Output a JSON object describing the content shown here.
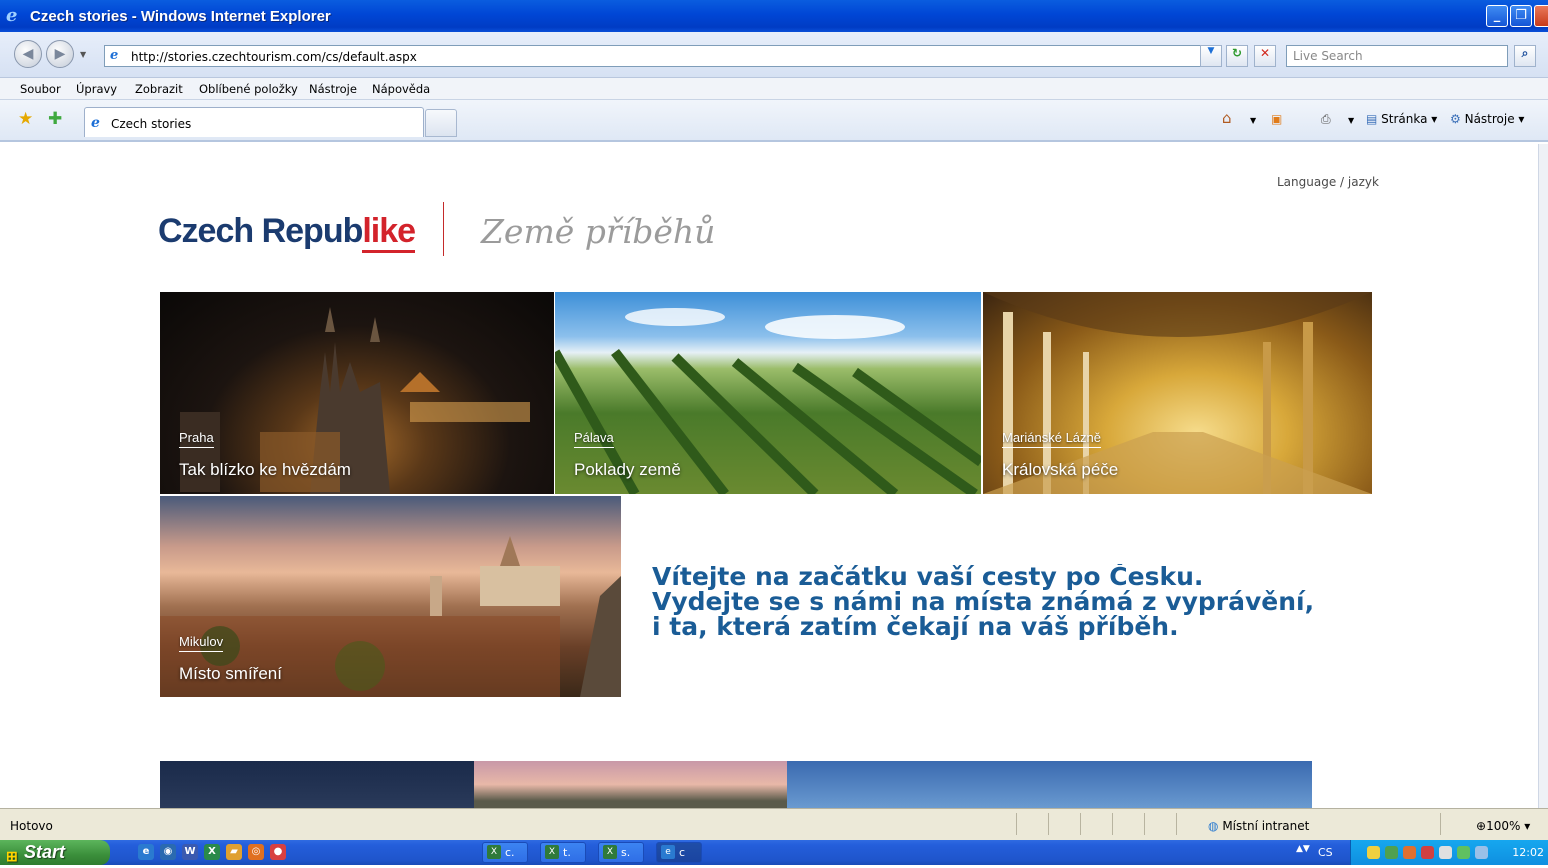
{
  "window": {
    "title": "Czech stories - Windows Internet Explorer",
    "minimize": "_",
    "maximize": "❐",
    "close": "✕"
  },
  "address_bar": {
    "back": "◀",
    "forward": "▶",
    "url": "http://stories.czechtourism.com/cs/default.aspx",
    "refresh": "↻",
    "stop": "✕",
    "search_placeholder": "Live Search",
    "search_go": "⌕"
  },
  "menu": [
    "Soubor",
    "Úpravy",
    "Zobrazit",
    "Oblíbené položky",
    "Nástroje",
    "Nápověda"
  ],
  "tabs": {
    "active_tab_title": "Czech stories"
  },
  "command_bar": {
    "page": "Stránka",
    "tools": "Nástroje"
  },
  "page": {
    "language_link": "Language / jazyk",
    "logo_main": "Czech Repub",
    "logo_accent": "like",
    "tagline": "Země příběhů",
    "tiles": [
      {
        "place": "Praha",
        "story": "Tak blízko ke hvězdám"
      },
      {
        "place": "Pálava",
        "story": "Poklady země"
      },
      {
        "place": "Mariánské Lázně",
        "story": "Královská péče"
      },
      {
        "place": "Mikulov",
        "story": "Místo smíření"
      }
    ],
    "welcome": [
      "Vítejte na začátku vaší cesty po Česku.",
      "Vydejte se s námi na místa známá z vyprávění,",
      "i ta, která zatím čekají na váš příběh."
    ]
  },
  "status_bar": {
    "status": "Hotovo",
    "zone": "Místní intranet",
    "zoom": "100%"
  },
  "taskbar": {
    "start": "Start",
    "buttons": [
      "c.",
      "t.",
      "s.",
      "c"
    ],
    "language": "CS",
    "clock": "12:02"
  }
}
